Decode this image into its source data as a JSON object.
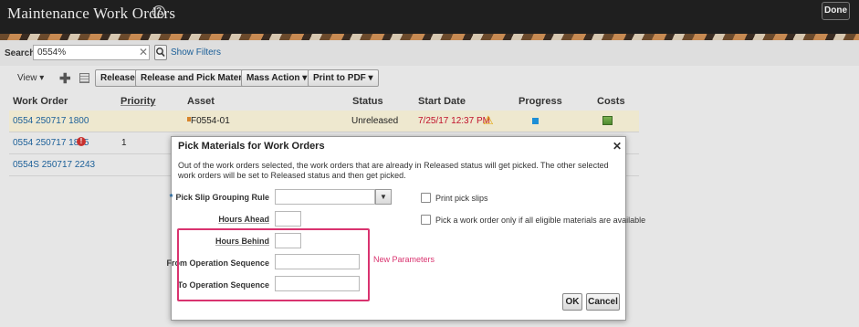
{
  "header": {
    "title": "Maintenance Work Orders",
    "help_icon": "?",
    "done_label": "Done"
  },
  "search": {
    "label": "Search",
    "value": "0554%",
    "clear_icon": "✕",
    "show_filters": "Show Filters"
  },
  "toolbar": {
    "view_label": "View ▾",
    "plus_icon": "✚",
    "buttons": [
      "Release",
      "Release and Pick Materials",
      "Mass Action ▾",
      "Print to PDF ▾"
    ]
  },
  "table": {
    "columns": [
      "Work Order",
      "Priority",
      "Asset",
      "Status",
      "Start Date",
      "Progress",
      "Costs"
    ],
    "rows": [
      {
        "work_order": "0554 250717 1800",
        "priority": "",
        "asset": "F0554-01",
        "status": "Unreleased",
        "start_date": "7/25/17 12:37 PM"
      },
      {
        "work_order": "0554 250717 1815",
        "priority": "1",
        "asset": "",
        "status": "",
        "start_date": ""
      },
      {
        "work_order": "0554S 250717 2243",
        "priority": "",
        "asset": "",
        "status": "",
        "start_date": ""
      }
    ]
  },
  "dialog": {
    "title": "Pick Materials for Work Orders",
    "close_icon": "✕",
    "description": "Out of the work orders selected, the work orders that are already in Released status will get picked. The other selected work orders will be set to Released status and then get picked.",
    "required_mark": "*",
    "fields": {
      "grouping_rule": "Pick Slip Grouping Rule",
      "hours_ahead": "Hours Ahead",
      "hours_behind": "Hours Behind",
      "from_op_seq": "From Operation Sequence",
      "to_op_seq": "To Operation Sequence"
    },
    "checkboxes": {
      "print_pick_slips": "Print pick slips",
      "pick_all_eligible": "Pick a work order only if all eligible materials are available"
    },
    "new_parameters": "New Parameters",
    "ok_label": "OK",
    "cancel_label": "Cancel",
    "select_arrow": "▼"
  },
  "colors": {
    "accent": "#1b5f98",
    "highlight": "#d9336f",
    "selected_row": "#eee8cf",
    "header_bg": "#1f1f1f"
  }
}
